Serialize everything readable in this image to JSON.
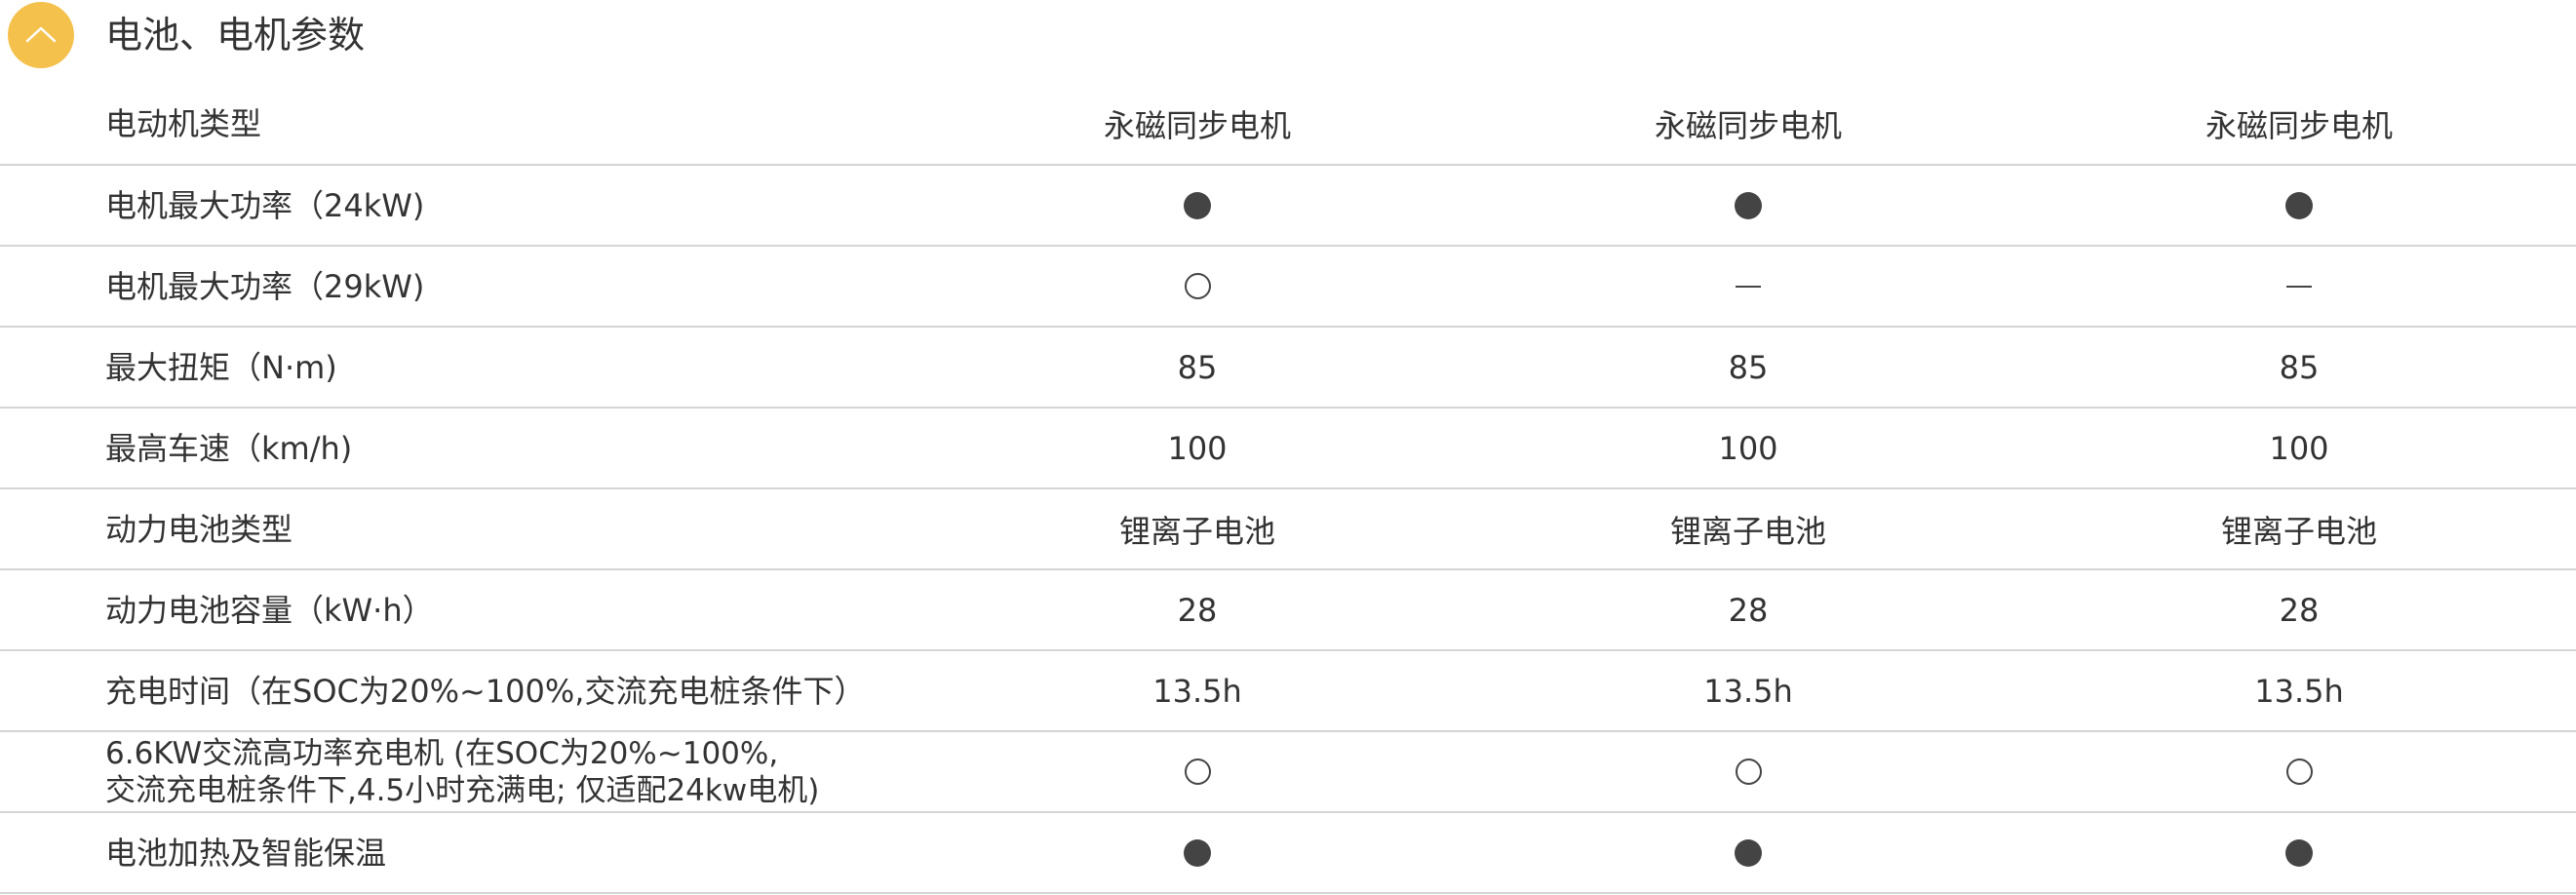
{
  "section": {
    "title": "电池、电机参数",
    "toggle_icon": "chevron-up-icon",
    "accent_color": "#f5c14d"
  },
  "rows": [
    {
      "label": "电动机类型",
      "values": [
        {
          "kind": "text",
          "text": "永磁同步电机"
        },
        {
          "kind": "text",
          "text": "永磁同步电机"
        },
        {
          "kind": "text",
          "text": "永磁同步电机"
        }
      ]
    },
    {
      "label": "电机最大功率（24kW)",
      "values": [
        {
          "kind": "filled",
          "meaning": "standard"
        },
        {
          "kind": "filled",
          "meaning": "standard"
        },
        {
          "kind": "filled",
          "meaning": "standard"
        }
      ]
    },
    {
      "label": "电机最大功率（29kW)",
      "values": [
        {
          "kind": "empty",
          "meaning": "optional"
        },
        {
          "kind": "dash",
          "meaning": "not-available"
        },
        {
          "kind": "dash",
          "meaning": "not-available"
        }
      ]
    },
    {
      "label": "最大扭矩（N·m)",
      "values": [
        {
          "kind": "text",
          "text": "85"
        },
        {
          "kind": "text",
          "text": "85"
        },
        {
          "kind": "text",
          "text": "85"
        }
      ]
    },
    {
      "label": "最高车速（km/h)",
      "values": [
        {
          "kind": "text",
          "text": "100"
        },
        {
          "kind": "text",
          "text": "100"
        },
        {
          "kind": "text",
          "text": "100"
        }
      ]
    },
    {
      "label": "动力电池类型",
      "values": [
        {
          "kind": "text",
          "text": "锂离子电池"
        },
        {
          "kind": "text",
          "text": "锂离子电池"
        },
        {
          "kind": "text",
          "text": "锂离子电池"
        }
      ]
    },
    {
      "label": "动力电池容量（kW·h）",
      "values": [
        {
          "kind": "text",
          "text": "28"
        },
        {
          "kind": "text",
          "text": "28"
        },
        {
          "kind": "text",
          "text": "28"
        }
      ]
    },
    {
      "label": "充电时间（在SOC为20%~100%,交流充电桩条件下）",
      "values": [
        {
          "kind": "text",
          "text": "13.5h"
        },
        {
          "kind": "text",
          "text": "13.5h"
        },
        {
          "kind": "text",
          "text": "13.5h"
        }
      ]
    },
    {
      "label_lines": [
        "6.6KW交流高功率充电机 (在SOC为20%~100%,",
        "交流充电桩条件下,4.5小时充满电; 仅适配24kw电机)"
      ],
      "values": [
        {
          "kind": "empty",
          "meaning": "optional"
        },
        {
          "kind": "empty",
          "meaning": "optional"
        },
        {
          "kind": "empty",
          "meaning": "optional"
        }
      ]
    },
    {
      "label": "电池加热及智能保温",
      "values": [
        {
          "kind": "filled",
          "meaning": "standard"
        },
        {
          "kind": "filled",
          "meaning": "standard"
        },
        {
          "kind": "filled",
          "meaning": "standard"
        }
      ]
    }
  ]
}
